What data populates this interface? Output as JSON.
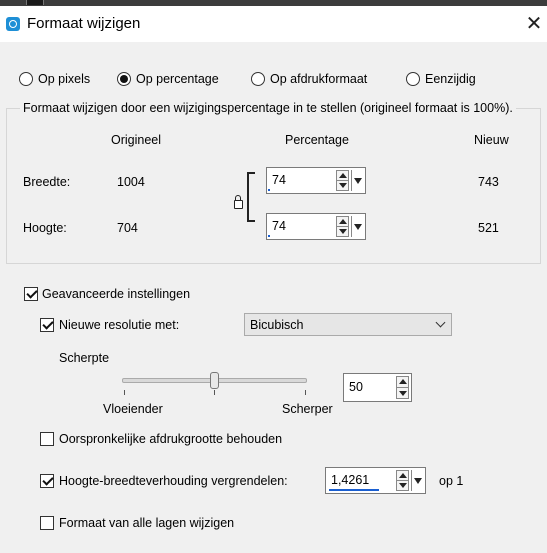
{
  "window": {
    "title": "Formaat wijzigen",
    "close_glyph": "✕"
  },
  "mode": {
    "options": [
      {
        "label": "Op pixels",
        "selected": false
      },
      {
        "label": "Op percentage",
        "selected": true
      },
      {
        "label": "Op afdrukformaat",
        "selected": false
      },
      {
        "label": "Eenzijdig",
        "selected": false
      }
    ]
  },
  "resize": {
    "group_title": "Formaat wijzigen door een wijzigingspercentage in te stellen (origineel formaat  is 100%).",
    "col_original": "Origineel",
    "col_percentage": "Percentage",
    "col_new": "Nieuw",
    "rows": [
      {
        "label": "Breedte:",
        "original": "1004",
        "percentage": "74",
        "new": "743"
      },
      {
        "label": "Hoogte:",
        "original": "704",
        "percentage": "74",
        "new": "521"
      }
    ],
    "aspect_locked": true
  },
  "advanced": {
    "label": "Geavanceerde instellingen",
    "checked": true,
    "resolution": {
      "label": "Nieuwe resolutie met:",
      "checked": true,
      "method": "Bicubisch"
    },
    "sharpness": {
      "title": "Scherpte",
      "value": "50",
      "level": 0.5,
      "min_label": "Vloeiender",
      "max_label": "Scherper"
    },
    "keep_print_size": {
      "label": "Oorspronkelijke afdrukgrootte behouden",
      "checked": false
    },
    "lock_ratio": {
      "label": "Hoogte-breedteverhouding vergrendelen:",
      "checked": true,
      "value": "1,4261",
      "suffix": "op 1"
    },
    "all_layers": {
      "label": "Formaat van alle lagen wijzigen",
      "checked": false
    }
  },
  "colors": {
    "accent": "#1a5fd1",
    "dialog_bg": "#f0f0f0"
  }
}
